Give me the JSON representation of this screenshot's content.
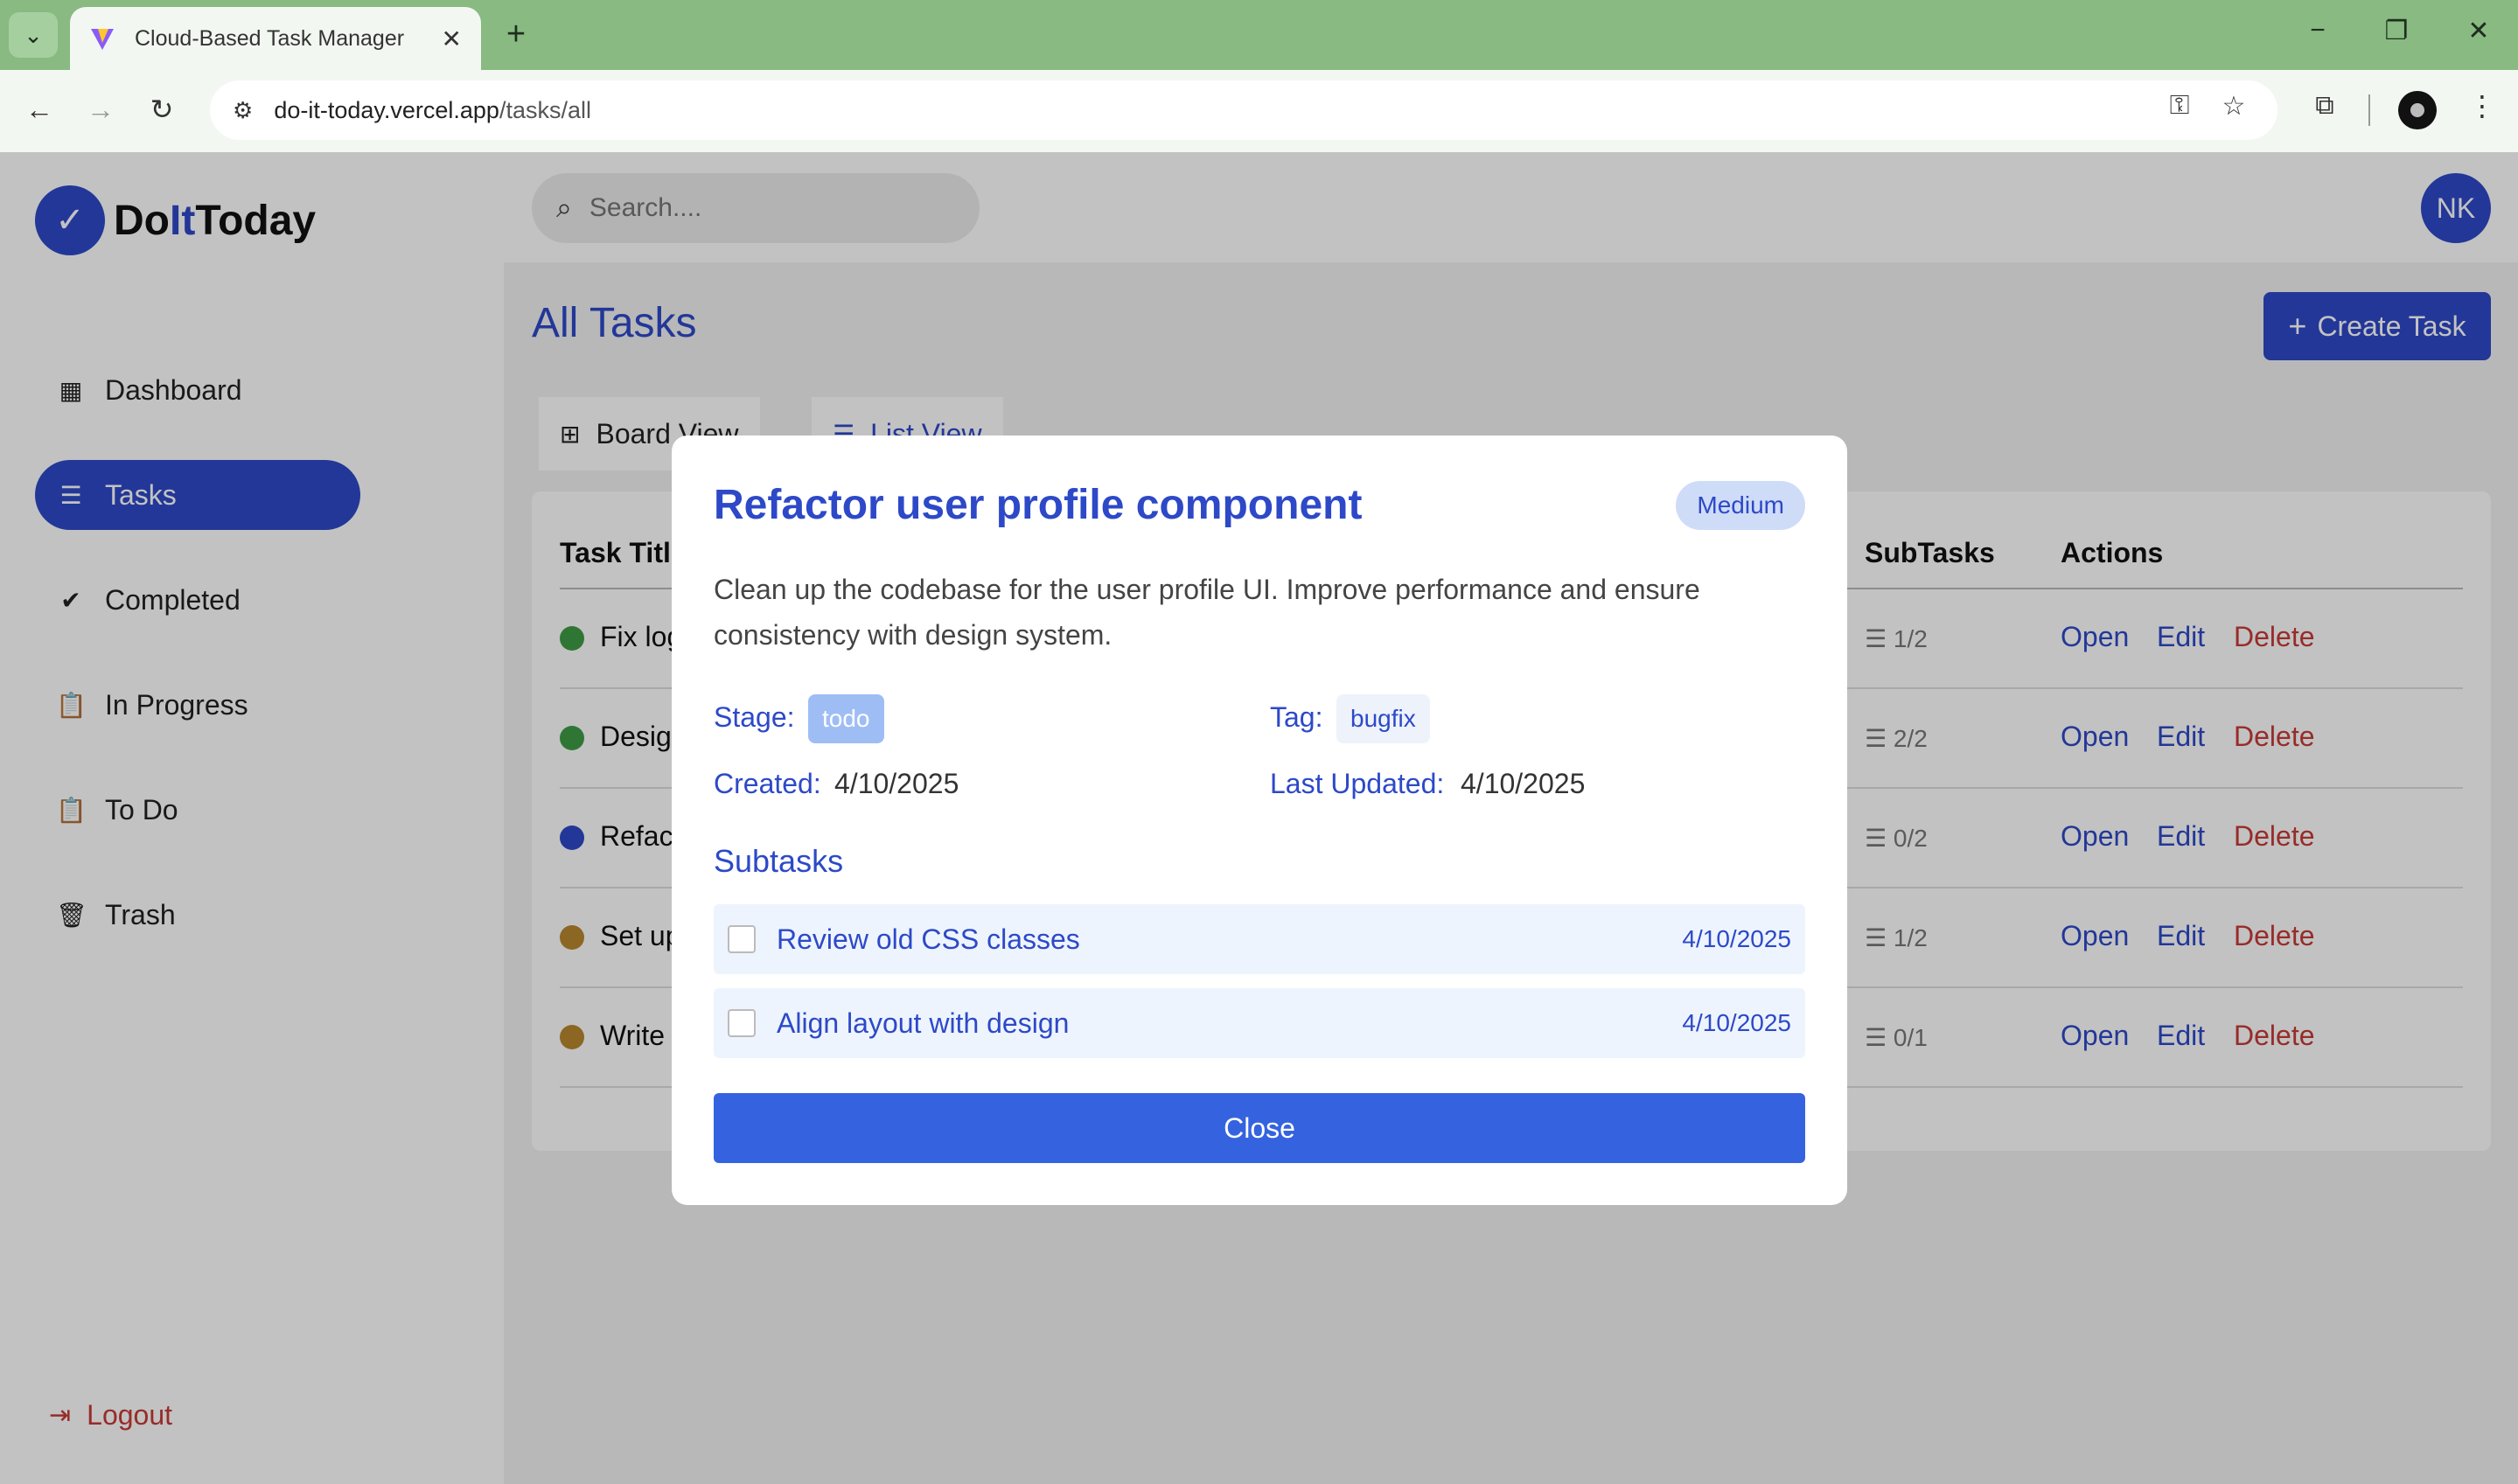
{
  "browser": {
    "tab_title": "Cloud-Based Task Manager",
    "url_domain": "do-it-today.vercel.app",
    "url_path": "/tasks/all"
  },
  "app": {
    "logo_do": "Do",
    "logo_it": "It",
    "logo_today": "Today",
    "search_placeholder": "Search....",
    "avatar_initials": "NK"
  },
  "sidebar": {
    "items": [
      {
        "label": "Dashboard",
        "icon": "dashboard-icon"
      },
      {
        "label": "Tasks",
        "icon": "list-icon"
      },
      {
        "label": "Completed",
        "icon": "check-circle-icon"
      },
      {
        "label": "In Progress",
        "icon": "clipboard-icon"
      },
      {
        "label": "To Do",
        "icon": "clipboard-icon"
      },
      {
        "label": "Trash",
        "icon": "trash-icon"
      }
    ],
    "logout_label": "Logout"
  },
  "main": {
    "page_title": "All Tasks",
    "create_label": "Create Task",
    "views": [
      "Board View",
      "List View"
    ],
    "table": {
      "headers": {
        "task_title": "Task Title",
        "subtasks": "SubTasks",
        "actions": "Actions"
      },
      "rows": [
        {
          "title": "Fix log",
          "subtasks": "1/2",
          "color": "#3e9b46"
        },
        {
          "title": "Design",
          "subtasks": "2/2",
          "color": "#3e9b46"
        },
        {
          "title": "Refactor",
          "subtasks": "0/2",
          "color": "#2d49c8"
        },
        {
          "title": "Set up",
          "subtasks": "1/2",
          "color": "#b8862e"
        },
        {
          "title": "Write",
          "subtasks": "0/1",
          "color": "#b8862e"
        }
      ],
      "actions": {
        "open": "Open",
        "edit": "Edit",
        "delete": "Delete"
      }
    }
  },
  "modal": {
    "title": "Refactor user profile component",
    "priority": "Medium",
    "description": "Clean up the codebase for the user profile UI. Improve performance and ensure consistency with design system.",
    "stage_label": "Stage:",
    "stage_value": "todo",
    "tag_label": "Tag:",
    "tag_value": "bugfix",
    "created_label": "Created:",
    "created_value": "4/10/2025",
    "updated_label": "Last Updated:",
    "updated_value": "4/10/2025",
    "subtasks_heading": "Subtasks",
    "subtasks": [
      {
        "title": "Review old CSS classes",
        "date": "4/10/2025"
      },
      {
        "title": "Align layout with design",
        "date": "4/10/2025"
      }
    ],
    "close_label": "Close"
  }
}
